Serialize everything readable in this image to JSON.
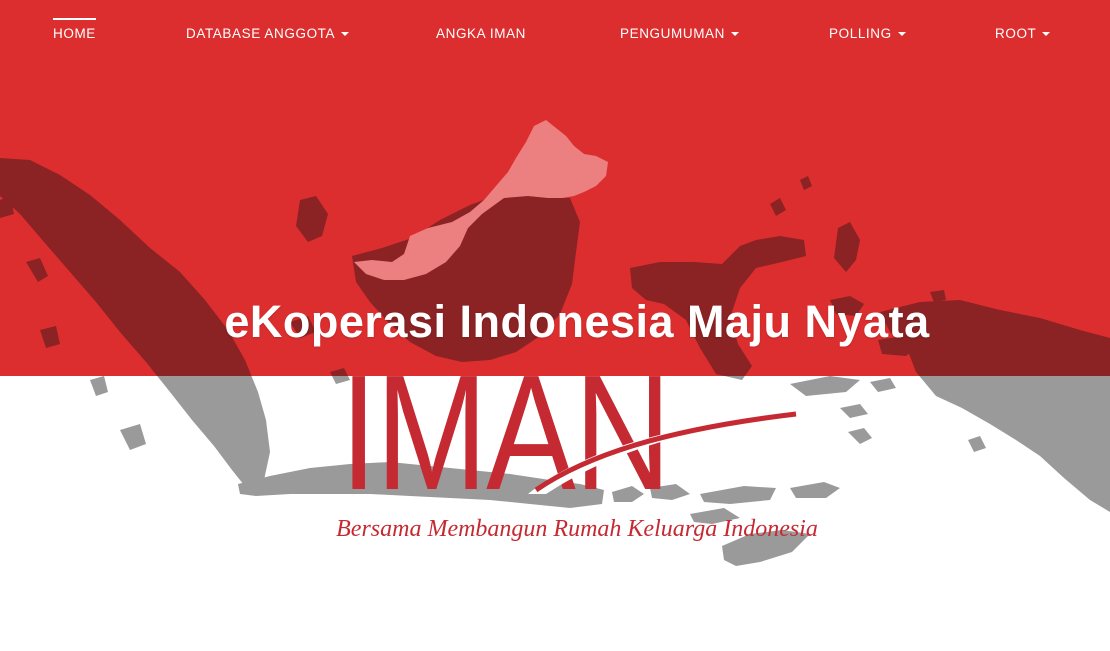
{
  "nav": {
    "items": [
      {
        "label": "HOME",
        "dropdown": false,
        "active": true
      },
      {
        "label": "DATABASE ANGGOTA",
        "dropdown": true,
        "active": false
      },
      {
        "label": "ANGKA IMAN",
        "dropdown": false,
        "active": false
      },
      {
        "label": "PENGUMUMAN",
        "dropdown": true,
        "active": false
      },
      {
        "label": "POLLING",
        "dropdown": true,
        "active": false
      },
      {
        "label": "ROOT",
        "dropdown": true,
        "active": false
      }
    ]
  },
  "hero": {
    "title": "eKoperasi Indonesia Maju Nyata",
    "logo_text": "IMAN",
    "tagline": "Bersama Membangun Rumah Keluarga Indonesia"
  },
  "colors": {
    "flag_red": "#dc2e2f",
    "flag_white": "#ffffff",
    "map_dark": "#8b2224",
    "map_light": "#ec8080",
    "map_gray": "#9a9a9a",
    "logo_red": "#c52a33"
  },
  "icons": {
    "caret": "caret-down-icon",
    "background": "indonesia-map-illustration"
  }
}
